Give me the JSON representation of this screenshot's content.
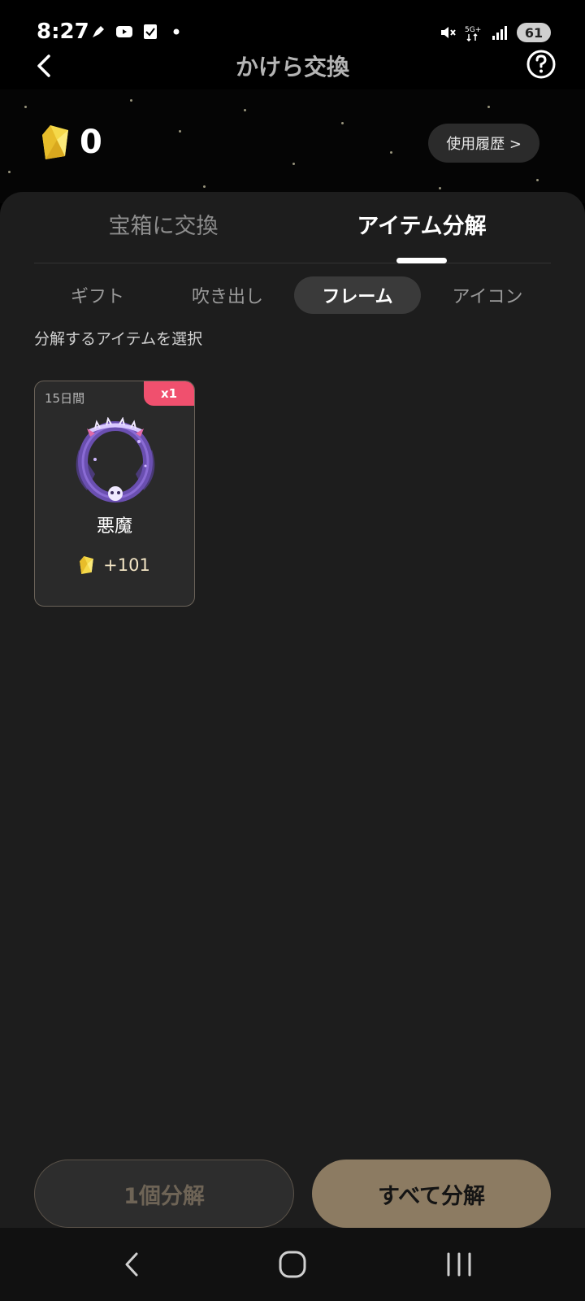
{
  "status_bar": {
    "time": "8:27",
    "battery": "61",
    "network": "5G+"
  },
  "header": {
    "title": "かけら交換"
  },
  "balance": {
    "value": "0"
  },
  "history_button": {
    "label": "使用履歴 >"
  },
  "main_tabs": [
    {
      "label": "宝箱に交換",
      "active": false
    },
    {
      "label": "アイテム分解",
      "active": true
    }
  ],
  "sub_tabs": [
    {
      "label": "ギフト",
      "active": false
    },
    {
      "label": "吹き出し",
      "active": false
    },
    {
      "label": "フレーム",
      "active": true
    },
    {
      "label": "アイコン",
      "active": false
    }
  ],
  "instruction": "分解するアイテムを選択",
  "items": [
    {
      "duration": "15日間",
      "quantity": "x1",
      "name": "悪魔",
      "reward": "+101"
    }
  ],
  "buttons": {
    "disassemble_one": "1個分解",
    "disassemble_all": "すべて分解"
  },
  "colors": {
    "accent_gold": "#8c7b62",
    "badge_pink": "#f0506e",
    "panel_bg": "#1d1d1d"
  }
}
